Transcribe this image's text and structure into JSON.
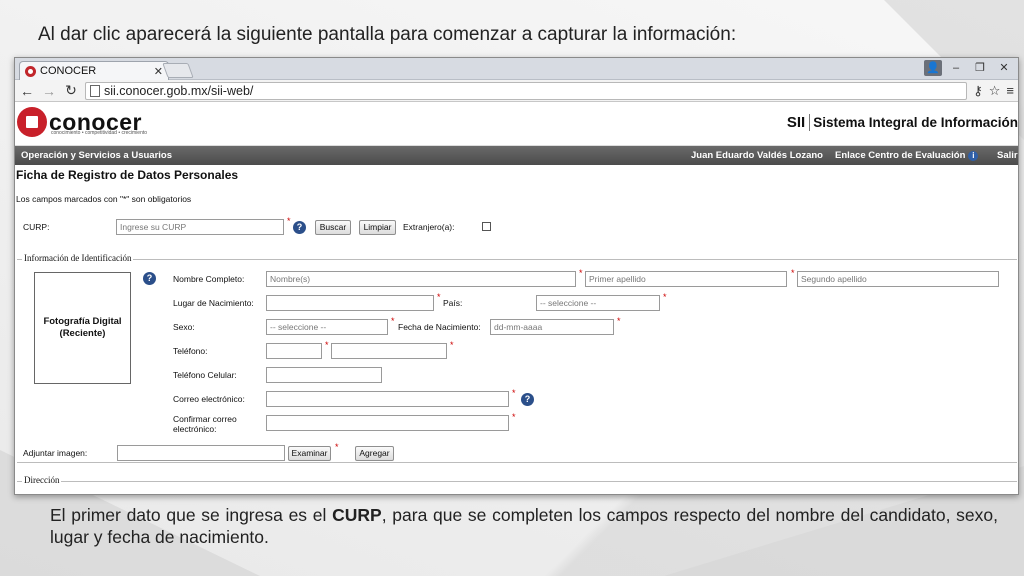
{
  "slide": {
    "heading": "Al dar clic aparecerá la siguiente pantalla para comenzar a capturar la información:",
    "caption_before": "El primer dato que se ingresa es el ",
    "caption_bold": "CURP",
    "caption_after": ", para que se completen los campos respecto del nombre del candidato, sexo, lugar y fecha de nacimiento."
  },
  "browser": {
    "tab_title": "CONOCER",
    "tab_close": "✕",
    "url": "sii.conocer.gob.mx/sii-web/",
    "icons": [
      "back-arrow-icon",
      "forward-arrow-icon",
      "reload-icon",
      "page-icon",
      "key-icon",
      "star-icon",
      "menu-icon",
      "user-icon",
      "minimize-icon",
      "maximize-icon",
      "close-icon"
    ]
  },
  "site": {
    "logo_text": "conocer",
    "logo_tagline": "conocimiento • competitividad • crecimiento",
    "brand_sii": "SII",
    "brand_name": "Sistema Integral de Información",
    "nav_menu": "Operación y Servicios a Usuarios",
    "nav_user": "Juan Eduardo Valdés Lozano",
    "nav_enlace": "Enlace Centro de Evaluación",
    "nav_salir": "Salir"
  },
  "form": {
    "title": "Ficha de Registro de Datos Personales",
    "required_note": "Los campos marcados con \"*\" son obligatorios",
    "curp_label": "CURP:",
    "curp_placeholder": "Ingrese su CURP",
    "buscar": "Buscar",
    "limpiar": "Limpiar",
    "extranjero_label": "Extranjero(a):",
    "section_identificacion": "Información de Identificación",
    "photo_label": "Fotografía Digital (Reciente)",
    "nombre_label": "Nombre Completo:",
    "nombre_placeholder": "Nombre(s)",
    "primer_apellido_placeholder": "Primer apellido",
    "segundo_apellido_placeholder": "Segundo apellido",
    "lugar_label": "Lugar de Nacimiento:",
    "pais_label": "País:",
    "pais_value": "-- seleccione --",
    "sexo_label": "Sexo:",
    "sexo_value": "-- seleccione --",
    "fecha_label": "Fecha de Nacimiento:",
    "fecha_placeholder": "dd-mm-aaaa",
    "telefono_label": "Teléfono:",
    "celular_label": "Teléfono Celular:",
    "correo_label": "Correo electrónico:",
    "confirmar_label_1": "Confirmar correo",
    "confirmar_label_2": "electrónico:",
    "adjuntar_label": "Adjuntar imagen:",
    "examinar": "Examinar",
    "agregar": "Agregar",
    "section_direccion": "Dirección",
    "required_mark": "*",
    "help_mark": "?"
  }
}
